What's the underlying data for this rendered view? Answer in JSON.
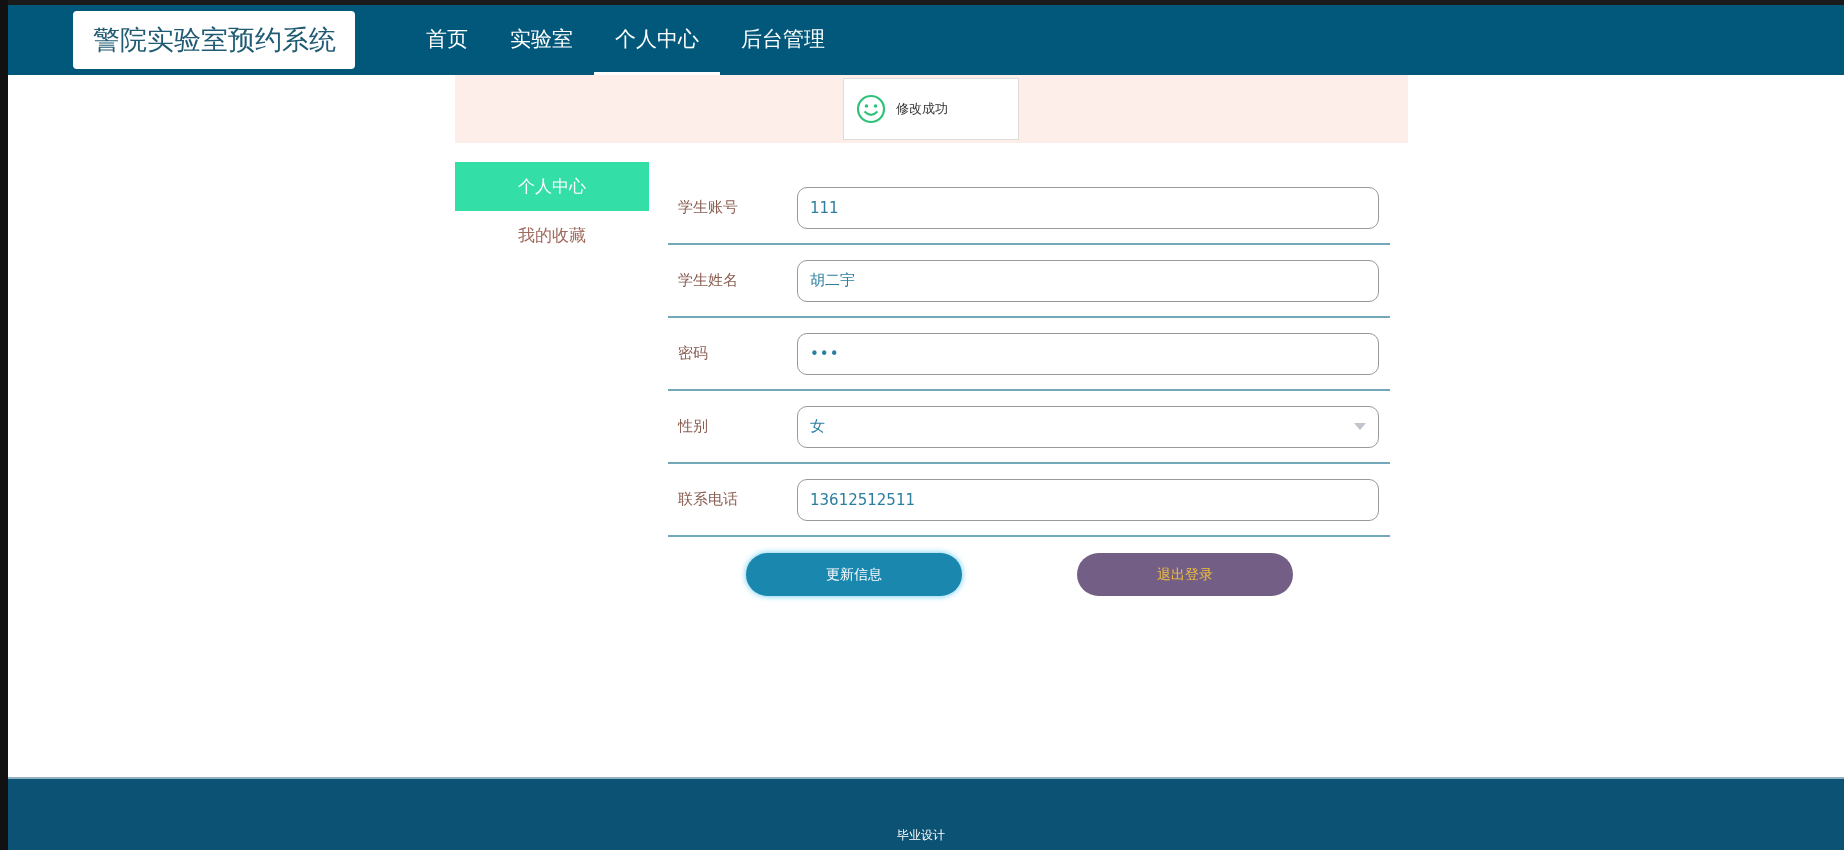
{
  "header": {
    "logo": "警院实验室预约系统",
    "nav": [
      {
        "label": "首页",
        "selected": false
      },
      {
        "label": "实验室",
        "selected": false
      },
      {
        "label": "个人中心",
        "selected": true
      },
      {
        "label": "后台管理",
        "selected": false
      }
    ]
  },
  "toast": {
    "message": "修改成功"
  },
  "sidebar": {
    "items": [
      {
        "label": "个人中心",
        "selected": true
      },
      {
        "label": "我的收藏",
        "selected": false
      }
    ]
  },
  "form": {
    "fields": [
      {
        "label": "学生账号",
        "kind": "text",
        "value": "111"
      },
      {
        "label": "学生姓名",
        "kind": "text",
        "value": "胡二宇"
      },
      {
        "label": "密码",
        "kind": "password",
        "value": "•••"
      },
      {
        "label": "性别",
        "kind": "select",
        "value": "女"
      },
      {
        "label": "联系电话",
        "kind": "text",
        "value": "13612512511"
      }
    ],
    "buttons": [
      {
        "label": "更新信息",
        "kind": "primary"
      },
      {
        "label": "退出登录",
        "kind": "logout"
      }
    ]
  },
  "footer": {
    "text": "毕业设计"
  }
}
